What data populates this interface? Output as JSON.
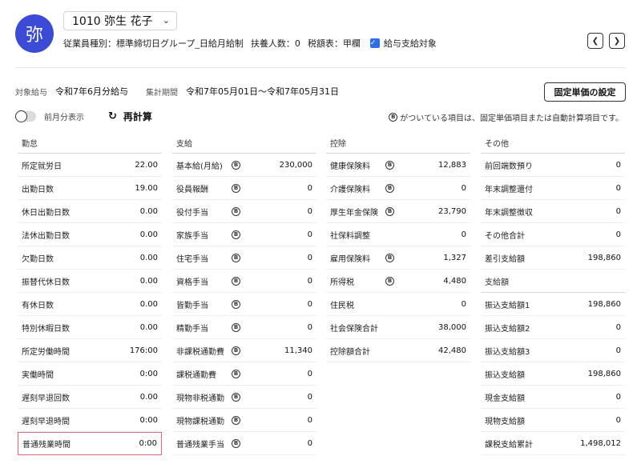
{
  "header": {
    "avatar_char": "弥",
    "employee": "1010 弥生 花子",
    "type_label": "従業員種別：標準締切日グループ_日給月給制",
    "dependents": "扶養人数：0",
    "tax_table": "税額表：甲欄",
    "payroll_target": "給与支給対象",
    "chevron_icon": "chevron-down-icon",
    "prev_icon": "chevron-left-icon",
    "next_icon": "chevron-right-icon",
    "checkbox_icon": "check-icon",
    "accent_color": "#3c4bd6",
    "checkbox_color": "#2f6fe4"
  },
  "period": {
    "target_label": "対象給与",
    "target_value": "令和7年6月分給与",
    "range_label": "集計期間",
    "range_value": "令和7年05月01日〜令和7年05月31日",
    "fixed_button": "固定単価の設定"
  },
  "controls": {
    "prev_month_label": "前月分表示",
    "recalc_label": "再計算",
    "recalc_icon": "refresh-icon",
    "note_text": "がついている項目は、固定単価項目または自動計算項目です。",
    "badge_char": "⑪"
  },
  "attendance": {
    "title": "勤怠",
    "rows": [
      {
        "name": "所定就労日",
        "value": "22.00"
      },
      {
        "name": "出勤日数",
        "value": "19.00"
      },
      {
        "name": "休日出勤日数",
        "value": "0.00"
      },
      {
        "name": "法休出勤日数",
        "value": "0.00"
      },
      {
        "name": "欠勤日数",
        "value": "0.00"
      },
      {
        "name": "振替代休日数",
        "value": "0.00"
      },
      {
        "name": "有休日数",
        "value": "0.00"
      },
      {
        "name": "特別休暇日数",
        "value": "0.00"
      },
      {
        "name": "所定労働時間",
        "value": "176:00"
      },
      {
        "name": "実働時間",
        "value": "0:00"
      },
      {
        "name": "遅刻早退回数",
        "value": "0.00"
      },
      {
        "name": "遅刻早退時間",
        "value": "0:00"
      },
      {
        "name": "普通残業時間",
        "value": "0:00"
      }
    ]
  },
  "payments": {
    "title": "支給",
    "rows": [
      {
        "name": "基本給(月給)",
        "value": "230,000"
      },
      {
        "name": "役員報酬",
        "value": "0"
      },
      {
        "name": "役付手当",
        "value": "0"
      },
      {
        "name": "家族手当",
        "value": "0"
      },
      {
        "name": "住宅手当",
        "value": "0"
      },
      {
        "name": "資格手当",
        "value": "0"
      },
      {
        "name": "皆勤手当",
        "value": "0"
      },
      {
        "name": "精勤手当",
        "value": "0"
      },
      {
        "name": "非課税通勤費",
        "value": "11,340"
      },
      {
        "name": "課税通勤費",
        "value": "0"
      },
      {
        "name": "現物非税通勤",
        "value": "0"
      },
      {
        "name": "現物課税通勤",
        "value": "0"
      },
      {
        "name": "普通残業手当",
        "value": "0"
      }
    ]
  },
  "deductions": {
    "title": "控除",
    "rows": [
      {
        "name": "健康保険料",
        "value": "12,883"
      },
      {
        "name": "介護保険料",
        "value": "0"
      },
      {
        "name": "厚生年金保険",
        "value": "23,790"
      },
      {
        "name": "社保料調整",
        "value": "0"
      },
      {
        "name": "雇用保険料",
        "value": "1,327"
      },
      {
        "name": "所得税",
        "value": "4,480"
      },
      {
        "name": "住民税",
        "value": "0"
      },
      {
        "name": "社会保険合計",
        "value": "38,000"
      },
      {
        "name": "控除額合計",
        "value": "42,480"
      }
    ]
  },
  "others": {
    "title": "その他",
    "rows": [
      {
        "name": "前回端数預り",
        "value": "0"
      },
      {
        "name": "年末調整還付",
        "value": "0"
      },
      {
        "name": "年末調整徴収",
        "value": "0"
      },
      {
        "name": "その他合計",
        "value": "0"
      },
      {
        "name": "差引支給額",
        "value": "198,860"
      }
    ],
    "sub_title": "支給額",
    "sub_rows": [
      {
        "name": "振込支給額1",
        "value": "198,860"
      },
      {
        "name": "振込支給額2",
        "value": "0"
      },
      {
        "name": "振込支給額3",
        "value": "0"
      },
      {
        "name": "振込支給額",
        "value": "198,860"
      },
      {
        "name": "現金支給額",
        "value": "0"
      },
      {
        "name": "現物支給額",
        "value": "0"
      },
      {
        "name": "課税支給累計",
        "value": "1,498,012"
      }
    ]
  }
}
